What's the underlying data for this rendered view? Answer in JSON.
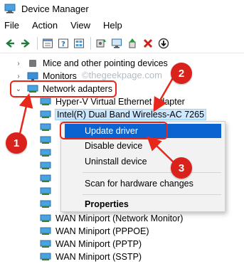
{
  "window": {
    "title": "Device Manager"
  },
  "menubar": {
    "items": [
      "File",
      "Action",
      "View",
      "Help"
    ]
  },
  "toolbar": {
    "buttons": [
      "back-icon",
      "forward-icon",
      "properties-icon",
      "help-icon",
      "show-hidden-icon",
      "update-driver-icon",
      "scan-hardware-icon",
      "enable-device-icon",
      "uninstall-device-icon",
      "download-driver-icon"
    ]
  },
  "tree": {
    "mice": "Mice and other pointing devices",
    "monitors": "Monitors",
    "network": "Network adapters",
    "children": [
      "Hyper-V Virtual Ethernet Adapter",
      "Intel(R) Dual Band Wireless-AC 7265",
      "WAN Miniport (Network Monitor)",
      "WAN Miniport (PPPOE)",
      "WAN Miniport (PPTP)",
      "WAN Miniport (SSTP)"
    ]
  },
  "watermark": "©thegeekpage.com",
  "context_menu": {
    "update": "Update driver",
    "disable": "Disable device",
    "uninstall": "Uninstall device",
    "scan": "Scan for hardware changes",
    "properties": "Properties"
  },
  "badges": {
    "one": "1",
    "two": "2",
    "three": "3"
  },
  "colors": {
    "highlight": "#0b63d2",
    "callout": "#e8261a",
    "selection": "#cce8ff"
  }
}
